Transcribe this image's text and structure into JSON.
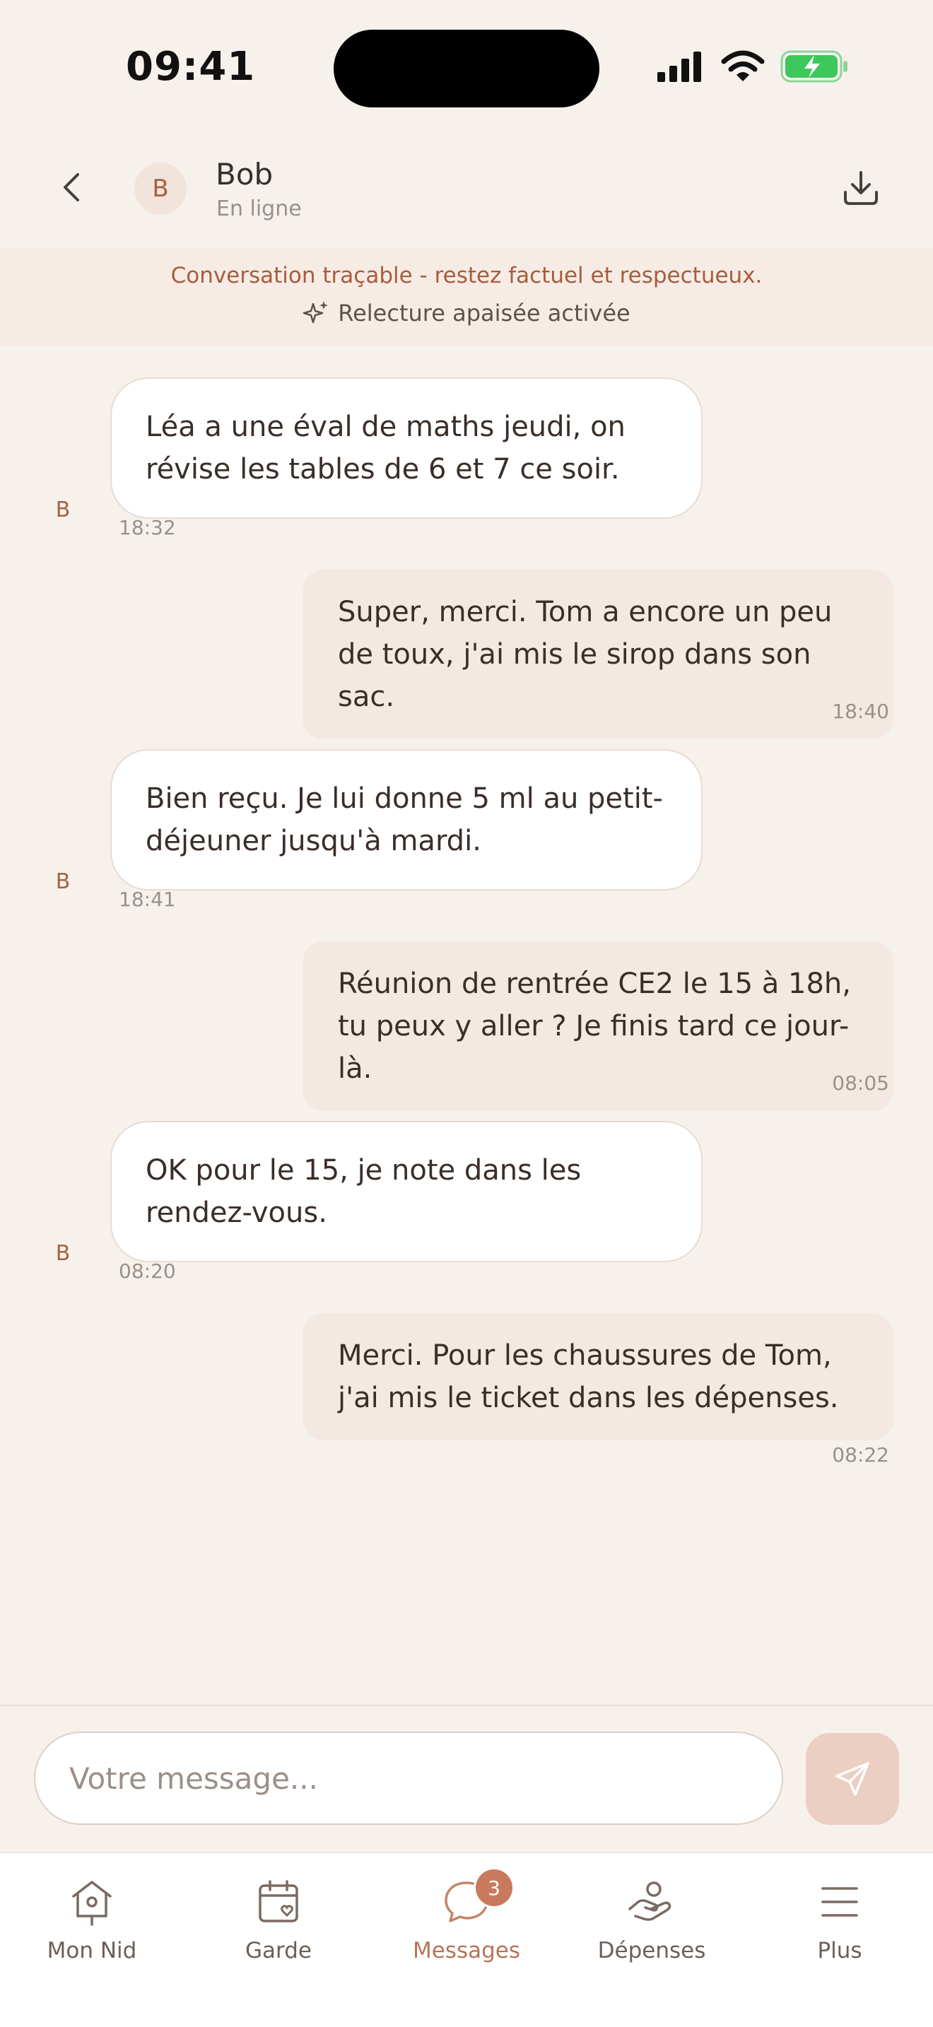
{
  "status_bar": {
    "time": "09:41"
  },
  "header": {
    "avatar_initial": "B",
    "name": "Bob",
    "status": "En ligne"
  },
  "notice": {
    "text": "Conversation traçable - restez factuel et respectueux.",
    "sub": "Relecture apaisée activée"
  },
  "messages": [
    {
      "dir": "in",
      "avatar": "B",
      "text": "Léa a une éval de maths jeudi, on révise les tables de 6 et 7 ce soir.",
      "time": "18:32"
    },
    {
      "dir": "out",
      "text": "Super, merci. Tom a encore un peu de toux, j'ai mis le sirop dans son sac.",
      "time": "18:40"
    },
    {
      "dir": "in",
      "avatar": "B",
      "text": "Bien reçu. Je lui donne 5 ml au petit-déjeuner jusqu'à mardi.",
      "time": "18:41"
    },
    {
      "dir": "out",
      "text": "Réunion de rentrée CE2 le 15 à 18h, tu peux y aller ? Je finis tard ce jour-là.",
      "time": "08:05"
    },
    {
      "dir": "in",
      "avatar": "B",
      "text": "OK pour le 15, je note dans les rendez-vous.",
      "time": "08:20"
    },
    {
      "dir": "out",
      "text": "Merci. Pour les chaussures de Tom, j'ai mis le ticket dans les dépenses.",
      "time": "08:22"
    }
  ],
  "composer": {
    "placeholder": "Votre message..."
  },
  "tabs": [
    {
      "label": "Mon Nid"
    },
    {
      "label": "Garde"
    },
    {
      "label": "Messages",
      "badge": "3"
    },
    {
      "label": "Dépenses"
    },
    {
      "label": "Plus"
    }
  ],
  "colors": {
    "background": "#F7F1EC",
    "accent": "#B5755A",
    "notice": "#A85C3C",
    "badge": "#C97A5C"
  }
}
